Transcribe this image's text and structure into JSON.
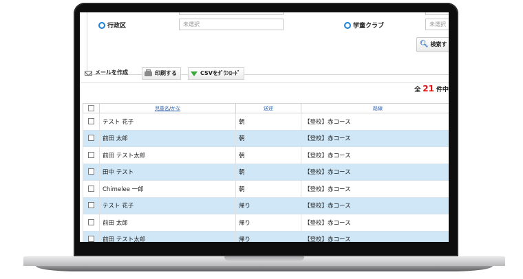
{
  "search": {
    "ward_label": "行政区",
    "ward_value": "未選択",
    "club_label": "学童クラブ",
    "club_value": "未選択",
    "search_button": "検索す"
  },
  "toolbar": {
    "mail_label": "メールを作成",
    "print_label": "印刷する",
    "csv_label": "CSVをﾀﾞｳﾝﾛｰﾄﾞ"
  },
  "count": {
    "prefix": "全",
    "value": "21",
    "suffix": "件中"
  },
  "table": {
    "headers": {
      "name_a": "児童名",
      "slash": "/",
      "name_b": "かな",
      "trip": "送迎",
      "route": "路線"
    },
    "rows": [
      {
        "name": "テスト 花子",
        "trip": "朝",
        "route": "【登校】赤コース"
      },
      {
        "name": "前田 太郎",
        "trip": "朝",
        "route": "【登校】赤コース"
      },
      {
        "name": "前田 テスト太郎",
        "trip": "朝",
        "route": "【登校】赤コース"
      },
      {
        "name": "田中 テスト",
        "trip": "朝",
        "route": "【登校】赤コース"
      },
      {
        "name": "Chimelee 一郎",
        "trip": "朝",
        "route": "【登校】赤コース"
      },
      {
        "name": "テスト 花子",
        "trip": "帰り",
        "route": "【登校】赤コース"
      },
      {
        "name": "前田 太郎",
        "trip": "帰り",
        "route": "【登校】赤コース"
      },
      {
        "name": "前田 テスト太郎",
        "trip": "帰り",
        "route": "【登校】赤コース"
      }
    ]
  },
  "colors": {
    "accent": "#1a7fd4",
    "row_highlight": "#cfe7f7",
    "count_number": "#e01010"
  }
}
